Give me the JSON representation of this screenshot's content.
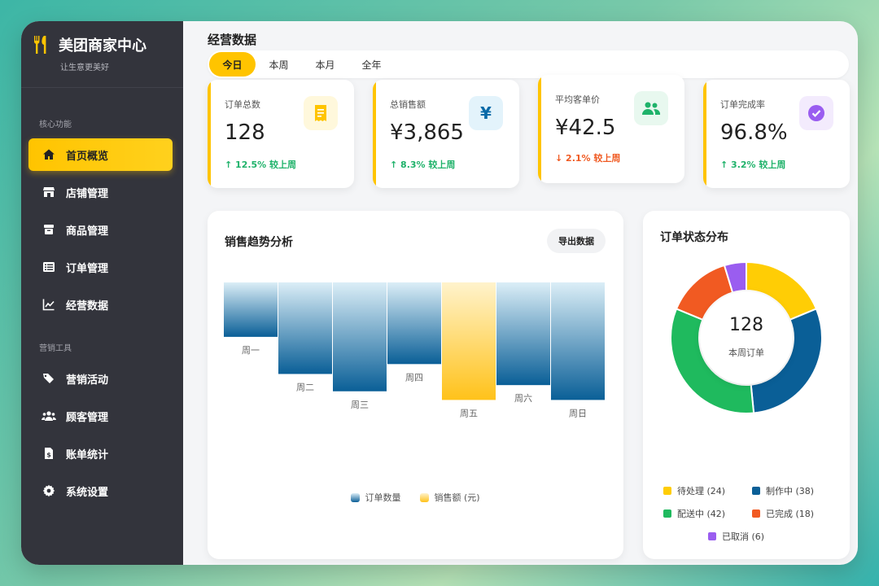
{
  "brand": {
    "title": "美团商家中心",
    "subtitle": "让生意更美好"
  },
  "sidebar": {
    "section_core": "核心功能",
    "section_marketing": "营销工具",
    "items": [
      {
        "label": "首页概览",
        "icon": "home-icon"
      },
      {
        "label": "店铺管理",
        "icon": "store-icon"
      },
      {
        "label": "商品管理",
        "icon": "box-icon"
      },
      {
        "label": "订单管理",
        "icon": "list-icon"
      },
      {
        "label": "经营数据",
        "icon": "line-chart-icon"
      },
      {
        "label": "营销活动",
        "icon": "tags-icon"
      },
      {
        "label": "顾客管理",
        "icon": "users-icon"
      },
      {
        "label": "账单统计",
        "icon": "invoice-icon"
      },
      {
        "label": "系统设置",
        "icon": "gear-icon"
      }
    ],
    "active_index": 0
  },
  "header": {
    "title": "经营数据"
  },
  "tabs": {
    "items": [
      "今日",
      "本周",
      "本月",
      "全年"
    ],
    "active": "今日"
  },
  "stats": [
    {
      "label": "订单总数",
      "value": "128",
      "change": "↑ 12.5% 较上周",
      "trend": "up",
      "icon": "receipt-icon",
      "icon_color": "#ffc400",
      "icon_bg": "#fff8dc"
    },
    {
      "label": "总销售额",
      "value": "¥3,865",
      "change": "↑ 8.3% 较上周",
      "trend": "up",
      "icon": "yen-icon",
      "icon_color": "#0a6aa8",
      "icon_bg": "#e3f3fb"
    },
    {
      "label": "平均客单价",
      "value": "¥42.5",
      "change": "↓ 2.1% 较上周",
      "trend": "down",
      "icon": "users-icon",
      "icon_color": "#1fb26a",
      "icon_bg": "#e8f8ef"
    },
    {
      "label": "订单完成率",
      "value": "96.8%",
      "change": "↑ 3.2% 较上周",
      "trend": "up",
      "icon": "check-circle-icon",
      "icon_color": "#9a5df0",
      "icon_bg": "#f3ebfd"
    }
  ],
  "sales_panel": {
    "title": "销售趋势分析",
    "export_label": "导出数据"
  },
  "orders_panel": {
    "title": "订单状态分布",
    "center_value": "128",
    "center_label": "本周订单"
  },
  "colors": {
    "accent": "#ffc400",
    "blue": "#0a5f97",
    "green": "#1fba5e",
    "orange": "#f15a22",
    "purple": "#9a5df0",
    "sidebar": "#33343c"
  },
  "chart_data": [
    {
      "type": "bar",
      "title": "销售趋势分析",
      "categories": [
        "周一",
        "周二",
        "周三",
        "周四",
        "周五",
        "周六",
        "周日"
      ],
      "series": [
        {
          "name": "订单数量",
          "values": [
            0.44,
            0.74,
            0.88,
            0.66,
            0.95,
            0.83,
            0.95
          ]
        }
      ],
      "highlight_index": 4,
      "highlight_series_name": "销售额 (元)",
      "legend": [
        "订单数量",
        "销售额 (元)"
      ],
      "legend_position": "bottom",
      "grid": false
    },
    {
      "type": "pie",
      "title": "订单状态分布",
      "donut": true,
      "slices": [
        {
          "label": "待处理 (24)",
          "value": 24,
          "color": "#ffcd05"
        },
        {
          "label": "制作中 (38)",
          "value": 38,
          "color": "#0a5f97"
        },
        {
          "label": "配送中 (42)",
          "value": 42,
          "color": "#1fba5e"
        },
        {
          "label": "已完成 (18)",
          "value": 18,
          "color": "#f15a22"
        },
        {
          "label": "已取消 (6)",
          "value": 6,
          "color": "#9a5df0"
        }
      ]
    }
  ]
}
